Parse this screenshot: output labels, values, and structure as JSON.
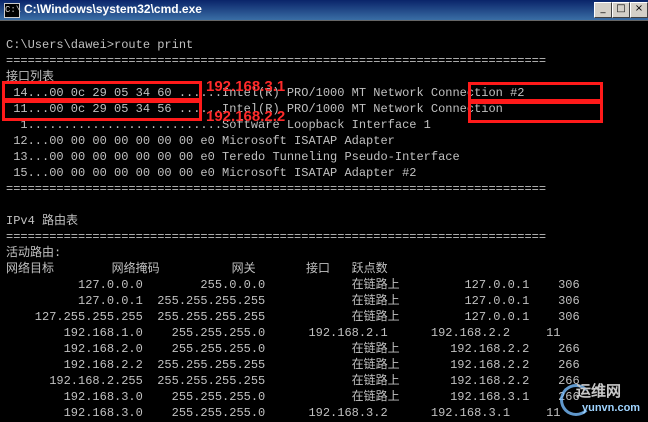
{
  "window": {
    "title": "C:\\Windows\\system32\\cmd.exe"
  },
  "console": {
    "lines": [
      "",
      "C:\\Users\\dawei>route print",
      "===========================================================================",
      "接口列表",
      " 14...00 0c 29 05 34 60 ......Intel(R) PRO/1000 MT Network Connection #2",
      " 11...00 0c 29 05 34 56 ......Intel(R) PRO/1000 MT Network Connection",
      "  1...........................Software Loopback Interface 1",
      " 12...00 00 00 00 00 00 00 e0 Microsoft ISATAP Adapter",
      " 13...00 00 00 00 00 00 00 e0 Teredo Tunneling Pseudo-Interface",
      " 15...00 00 00 00 00 00 00 e0 Microsoft ISATAP Adapter #2",
      "===========================================================================",
      "",
      "IPv4 路由表",
      "===========================================================================",
      "活动路由:",
      "网络目标        网络掩码          网关       接口   跃点数",
      "          127.0.0.0        255.0.0.0            在链路上         127.0.0.1    306",
      "          127.0.0.1  255.255.255.255            在链路上         127.0.0.1    306",
      "    127.255.255.255  255.255.255.255            在链路上         127.0.0.1    306",
      "        192.168.1.0    255.255.255.0      192.168.2.1      192.168.2.2     11",
      "        192.168.2.0    255.255.255.0            在链路上       192.168.2.2    266",
      "        192.168.2.2  255.255.255.255            在链路上       192.168.2.2    266",
      "      192.168.2.255  255.255.255.255            在链路上       192.168.2.2    266",
      "        192.168.3.0    255.255.255.0            在链路上       192.168.3.1    266",
      "        192.168.3.0    255.255.255.0      192.168.3.2      192.168.3.1     11"
    ]
  },
  "annotations": {
    "ip1": "192.168.3.1",
    "ip2": "192.168.2.2",
    "color": "#ff1a1a"
  },
  "watermark": {
    "logo": "运维网",
    "domain": "yunvn.com"
  },
  "buttons": {
    "minimize": "_",
    "maximize": "□",
    "close": "×"
  }
}
